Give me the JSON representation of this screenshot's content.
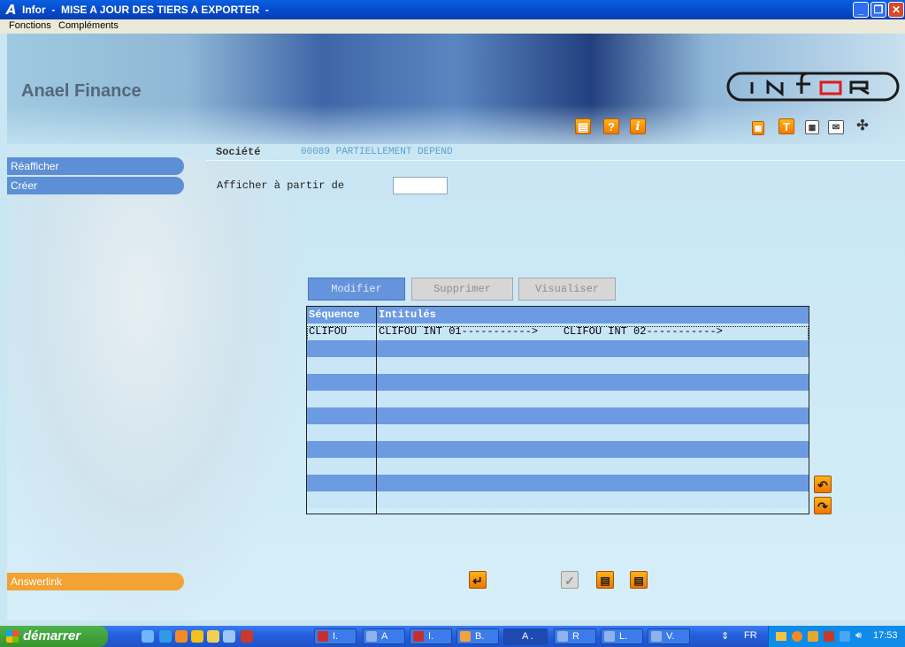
{
  "window": {
    "app_letter": "A",
    "title": "Infor  -  MISE A JOUR DES TIERS A EXPORTER  -"
  },
  "menu": {
    "items": [
      "Fonctions",
      "Compléments"
    ]
  },
  "brand": {
    "name": "Anael Finance",
    "logo_text": "INFOR"
  },
  "toolbar_icons": [
    "printer-icon",
    "help-icon",
    "info-icon",
    "calculator-icon",
    "text-icon",
    "grid-icon",
    "mail-icon",
    "network-icon"
  ],
  "sidebar": {
    "items": [
      {
        "label": "Réafficher"
      },
      {
        "label": "Créer"
      }
    ],
    "bottom_link": "Answerlink"
  },
  "form": {
    "societe_label": "Société",
    "societe_value": "00089 PARTIELLEMENT DEPEND",
    "afficher_label": "Afficher à partir de",
    "afficher_value": ""
  },
  "actions": [
    {
      "label": "Modifier",
      "state": "active"
    },
    {
      "label": "Supprimer",
      "state": "disabled"
    },
    {
      "label": "Visualiser",
      "state": "disabled"
    }
  ],
  "grid": {
    "columns": [
      "Séquence",
      "Intitulés"
    ],
    "rows": [
      {
        "sequence": "CLIFOU",
        "intitules": "CLIFOU INT 01----------->    CLIFOU INT 02----------->"
      }
    ]
  },
  "colors": {
    "row_blue": "#6c9be2",
    "row_light": "#c8e6f6",
    "nav_blue": "#5d8fd6",
    "accent_orange": "#f3a233"
  },
  "taskbar": {
    "start_label": "démarrer",
    "tasks": [
      "I.",
      "A",
      "I.",
      "B.",
      "A .",
      "R",
      "L.",
      "V."
    ],
    "language": "FR",
    "clock": "17:53"
  }
}
